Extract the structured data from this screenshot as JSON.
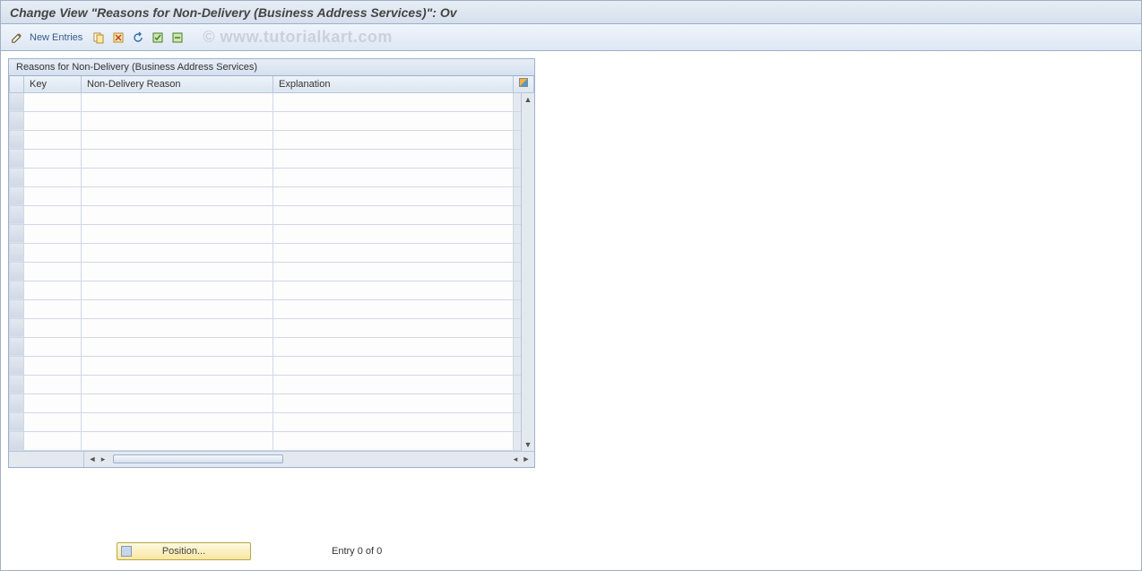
{
  "title": "Change View \"Reasons for Non-Delivery (Business Address Services)\": Ov",
  "toolbar": {
    "new_entries_label": "New Entries"
  },
  "watermark": "© www.tutorialkart.com",
  "panel": {
    "title": "Reasons for Non-Delivery (Business Address Services)",
    "columns": {
      "key": "Key",
      "reason": "Non-Delivery Reason",
      "explanation": "Explanation"
    },
    "rows": [
      {
        "key": "",
        "reason": "",
        "explanation": ""
      },
      {
        "key": "",
        "reason": "",
        "explanation": ""
      },
      {
        "key": "",
        "reason": "",
        "explanation": ""
      },
      {
        "key": "",
        "reason": "",
        "explanation": ""
      },
      {
        "key": "",
        "reason": "",
        "explanation": ""
      },
      {
        "key": "",
        "reason": "",
        "explanation": ""
      },
      {
        "key": "",
        "reason": "",
        "explanation": ""
      },
      {
        "key": "",
        "reason": "",
        "explanation": ""
      },
      {
        "key": "",
        "reason": "",
        "explanation": ""
      },
      {
        "key": "",
        "reason": "",
        "explanation": ""
      },
      {
        "key": "",
        "reason": "",
        "explanation": ""
      },
      {
        "key": "",
        "reason": "",
        "explanation": ""
      },
      {
        "key": "",
        "reason": "",
        "explanation": ""
      },
      {
        "key": "",
        "reason": "",
        "explanation": ""
      },
      {
        "key": "",
        "reason": "",
        "explanation": ""
      },
      {
        "key": "",
        "reason": "",
        "explanation": ""
      },
      {
        "key": "",
        "reason": "",
        "explanation": ""
      },
      {
        "key": "",
        "reason": "",
        "explanation": ""
      },
      {
        "key": "",
        "reason": "",
        "explanation": ""
      }
    ]
  },
  "footer": {
    "position_label": "Position...",
    "entry_text": "Entry 0 of 0"
  },
  "icons": {
    "pencil": "pencil-icon",
    "copy": "copy-icon",
    "delete": "delete-icon",
    "undo": "undo-icon",
    "select_all": "select-all-icon",
    "deselect": "deselect-icon"
  }
}
